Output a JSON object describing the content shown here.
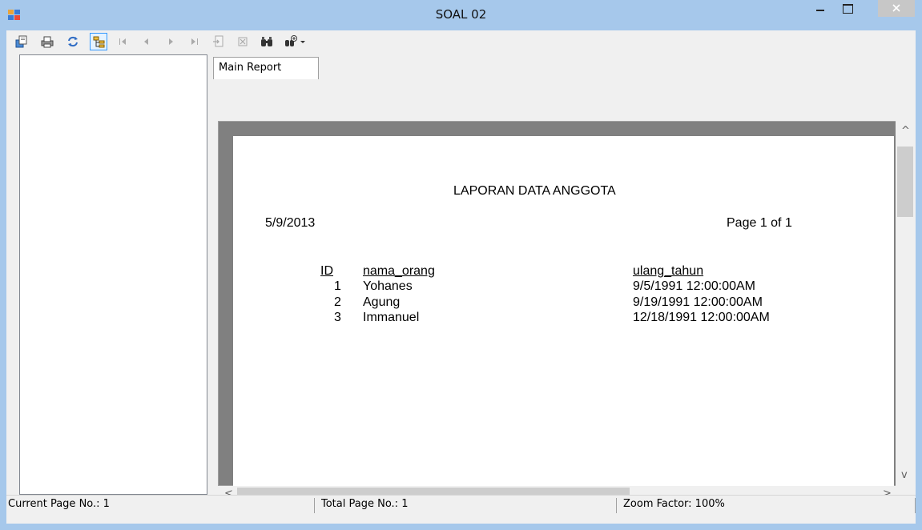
{
  "window": {
    "title": "SOAL 02",
    "colors": {
      "titlebar": "#a6c8eb",
      "close_button": "#c7c7c7"
    }
  },
  "toolbar": {
    "tools": [
      {
        "name": "export-icon",
        "enabled": true
      },
      {
        "name": "print-icon",
        "enabled": true
      },
      {
        "name": "refresh-icon",
        "enabled": true
      },
      {
        "name": "group-tree-icon",
        "enabled": true,
        "active": true
      },
      {
        "name": "first-page-icon",
        "enabled": false
      },
      {
        "name": "previous-page-icon",
        "enabled": false
      },
      {
        "name": "next-page-icon",
        "enabled": false
      },
      {
        "name": "last-page-icon",
        "enabled": false
      },
      {
        "name": "goto-page-icon",
        "enabled": false
      },
      {
        "name": "stop-icon",
        "enabled": false
      },
      {
        "name": "search-icon",
        "enabled": true
      },
      {
        "name": "zoom-icon",
        "enabled": true
      }
    ]
  },
  "tabs": [
    {
      "label": "Main Report"
    }
  ],
  "report": {
    "title": "LAPORAN DATA ANGGOTA",
    "print_date": "5/9/2013",
    "page_info": "Page 1 of 1",
    "columns": {
      "id": "ID",
      "name": "nama_orang",
      "birthday": "ulang_tahun"
    },
    "rows": [
      {
        "id": "1",
        "name": "Yohanes",
        "birthday": "9/5/1991  12:00:00AM"
      },
      {
        "id": "2",
        "name": "Agung",
        "birthday": "9/19/1991  12:00:00AM"
      },
      {
        "id": "3",
        "name": "Immanuel",
        "birthday": "12/18/1991  12:00:00AM"
      }
    ]
  },
  "statusbar": {
    "current_page": "Current Page No.: 1",
    "total_pages": "Total Page No.: 1",
    "zoom": "Zoom Factor: 100%"
  }
}
